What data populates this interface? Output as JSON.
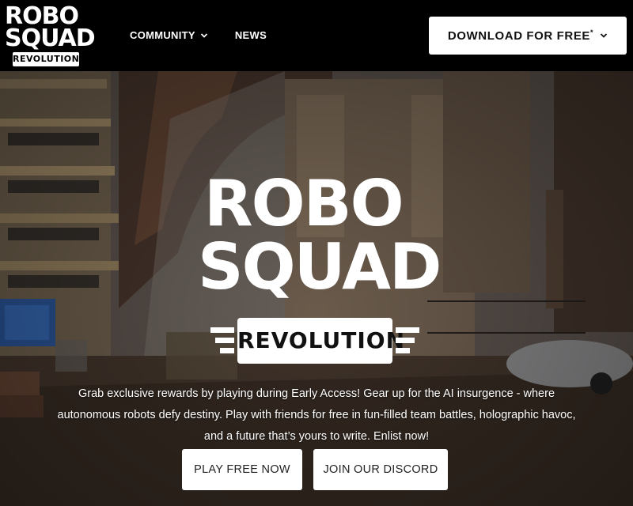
{
  "nav": {
    "logo": {
      "line1": "ROBO",
      "line2": "SQUAD",
      "banner": "REVOLUTION"
    },
    "links": [
      {
        "label": "COMMUNITY",
        "has_dropdown": true
      },
      {
        "label": "NEWS",
        "has_dropdown": false
      }
    ],
    "download": {
      "label": "DOWNLOAD FOR FREE",
      "mark": "*",
      "icon": "chevron-down-icon"
    }
  },
  "hero": {
    "logo": {
      "line1": "ROBO",
      "line2": "SQUAD",
      "banner": "REVOLUTION"
    },
    "description": "Grab exclusive rewards by playing during Early Access! Gear up for the AI insurgence - where autonomous robots defy destiny. Play with friends for free in fun-filled team battles, holographic havoc, and a future that’s yours to write. Enlist now!",
    "buttons": {
      "play": "PLAY FREE NOW",
      "discord": "JOIN OUR DISCORD"
    }
  },
  "colors": {
    "nav_bg": "#000000",
    "button_bg": "#ffffff",
    "text_light": "#ffffff",
    "text_dark": "#111111"
  }
}
